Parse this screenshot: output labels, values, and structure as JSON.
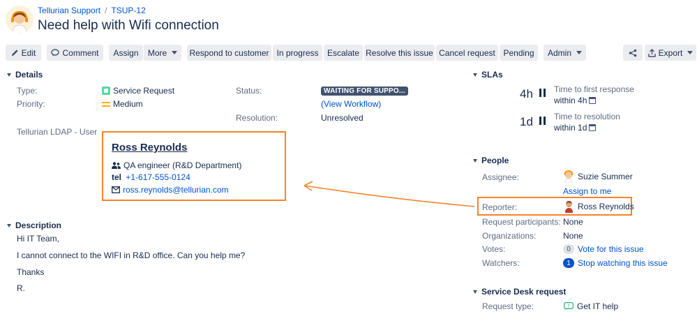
{
  "header": {
    "project": "Tellurian Support",
    "issue_key": "TSUP-12",
    "title": "Need help with Wifi connection"
  },
  "toolbar": {
    "edit": "Edit",
    "comment": "Comment",
    "assign": "Assign",
    "more": "More",
    "respond": "Respond to customer",
    "in_progress": "In progress",
    "escalate": "Escalate",
    "resolve": "Resolve this issue",
    "cancel": "Cancel request",
    "pending": "Pending",
    "admin": "Admin",
    "export": "Export"
  },
  "details": {
    "heading": "Details",
    "type_label": "Type:",
    "type_value": "Service Request",
    "priority_label": "Priority:",
    "priority_value": "Medium",
    "status_label": "Status:",
    "status_value": "WAITING FOR SUPPO...",
    "view_workflow": "(View Workflow)",
    "resolution_label": "Resolution:",
    "resolution_value": "Unresolved",
    "ldap_label": "Tellurian LDAP - User"
  },
  "user_card": {
    "name": "Ross Reynolds",
    "role": "QA engineer (R&D Department)",
    "tel_label": "tel",
    "tel": "+1-617-555-0124",
    "email": "ross.reynolds@tellurian.com"
  },
  "description": {
    "heading": "Description",
    "lines": [
      "Hi IT Team,",
      "I cannot connect to the WIFI in R&D office. Can you help me?",
      "Thanks",
      "R."
    ]
  },
  "slas": {
    "heading": "SLAs",
    "items": [
      {
        "value": "4h",
        "name": "Time to first response",
        "target": "within 4h"
      },
      {
        "value": "1d",
        "name": "Time to resolution",
        "target": "within 1d"
      }
    ]
  },
  "people": {
    "heading": "People",
    "assignee_label": "Assignee:",
    "assignee": "Suzie Summer",
    "assign_to_me": "Assign to me",
    "reporter_label": "Reporter:",
    "reporter": "Ross Reynolds",
    "participants_label": "Request participants:",
    "participants": "None",
    "organizations_label": "Organizations:",
    "organizations": "None",
    "votes_label": "Votes:",
    "votes_count": "0",
    "vote_link": "Vote for this issue",
    "watchers_label": "Watchers:",
    "watchers_count": "1",
    "watch_link": "Stop watching this issue"
  },
  "service_desk": {
    "heading": "Service Desk request",
    "request_type_label": "Request type:",
    "request_type": "Get IT help"
  },
  "colors": {
    "highlight": "#f5832a",
    "link": "#0052cc",
    "service_request_icon": "#57d9a3",
    "priority_medium": "#ffab00"
  }
}
